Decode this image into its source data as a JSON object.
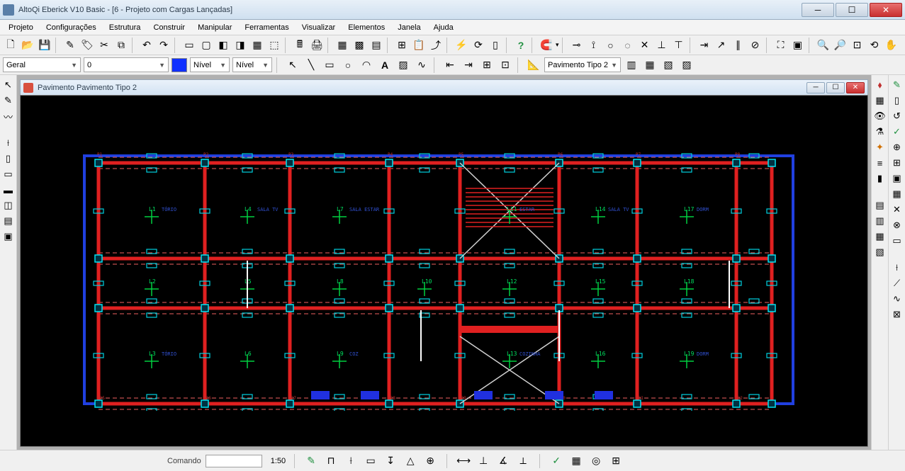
{
  "window": {
    "title": "AltoQi Eberick V10 Basic - [6 - Projeto com Cargas Lançadas]"
  },
  "menu": {
    "items": [
      "Projeto",
      "Configurações",
      "Estrutura",
      "Construir",
      "Manipular",
      "Ferramentas",
      "Visualizar",
      "Elementos",
      "Janela",
      "Ajuda"
    ]
  },
  "toolbar2": {
    "layer_combo": "Geral",
    "value_combo": "0",
    "level_label1": "Nível",
    "level_label2": "Nível",
    "pavement_combo": "Pavimento Tipo 2"
  },
  "document": {
    "title": "Pavimento Pavimento Tipo 2"
  },
  "status": {
    "command_label": "Comando",
    "command_value": "",
    "scale": "1:50"
  },
  "plan": {
    "columns_top": [
      "P1",
      "P2",
      "P3",
      "P4",
      "P5",
      "P6",
      "P7",
      "P8"
    ],
    "columns_mid1": [
      "P9",
      "P10",
      "P11",
      "",
      "",
      "P12",
      "P13",
      ""
    ],
    "columns_mid2": [
      "P17",
      "P18",
      "P19",
      "P20",
      "P21",
      "P22",
      ""
    ],
    "columns_bot": [
      "P25",
      "P26",
      "P27",
      "P28",
      "P29",
      "P30",
      "P31",
      "P32"
    ],
    "slabs_row1": [
      "L1",
      "L4",
      "L7",
      "",
      "L11",
      "L14",
      "L17"
    ],
    "slabs_row2": [
      "L2",
      "L5",
      "L8",
      "L10",
      "L12",
      "L15",
      "L18"
    ],
    "slabs_row3": [
      "L3",
      "L6",
      "L9",
      "",
      "L13",
      "L16",
      "L19"
    ],
    "rooms_row1": [
      "TÓRIO",
      "SALA TV",
      "SALA ESTAR",
      "",
      "ESTAR",
      "SALA TV",
      "DORM"
    ],
    "rooms_row2": [
      "",
      "",
      "",
      "",
      "",
      "",
      ""
    ],
    "rooms_row3": [
      "TÓRIO",
      "",
      "COZ",
      "",
      "COZINHA",
      "",
      "DORM"
    ]
  },
  "icons": {
    "new": "🗋",
    "open": "📂",
    "save": "💾",
    "undo": "↶",
    "redo": "↷",
    "magnet": "🧲",
    "help": "?",
    "zoom_in": "🔍+",
    "zoom_out": "🔍-",
    "zoom_fit": "⛶",
    "grid": "▦",
    "layers": "≡"
  }
}
